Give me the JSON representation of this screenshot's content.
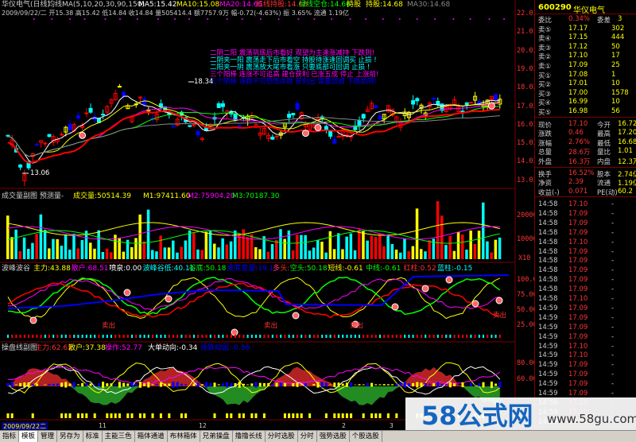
{
  "header": {
    "title": "华仪电气(日线)",
    "ma_label": "均线MA(5,10,20,30,90,150)",
    "ma5": "MA5:15.42",
    "ma10": "MA10:15.08",
    "ma20": "MA20:14.66",
    "signals": [
      "红线持股:14.68",
      "绿线空仓:14.66",
      "持股",
      "持股:14.68",
      "MA30:14.68"
    ],
    "ohlc_line": "2009/09/22/二  开15.38  高15.42  低14.84  收14.84  量505414.4  额7757.9万  幅-0.72(-4.63%)  振 3.65%  流通 1.19亿"
  },
  "annotations": [
    {
      "text": "二阴二阳 震荡筑底后市看好  观望为主逢涨减持  下跌则!",
      "color": "#ff00ff"
    },
    {
      "text": "二阴夹一阳 震荡走下后市看空  持股待涨逢回调买 止损 !",
      "color": "#00ffff"
    },
    {
      "text": "二阳夹一阴 震荡放大尾市看涨  只要底部可回调 止损 !",
      "color": "#00ffff"
    },
    {
      "text": "三个阳棒 连涨不可追高  建仓获利 已涨五成 停止 上涨前!",
      "color": "#ff00ff"
    },
    {
      "text": "三个阴棒 连跌不可恐慌杀跌 获利出 需要回调 下跌前阴!",
      "color": "#0000ff"
    }
  ],
  "price_labels": {
    "high": "18.34",
    "low": "13.06"
  },
  "price_axis": [
    "22.03",
    "21.03",
    "20.03",
    "19.03",
    "18.03",
    "17.03",
    "16.03",
    "15.03",
    "14.03",
    "13.03"
  ],
  "volume_panel": {
    "title": "成交量副图  预测量-",
    "values": [
      "成交量:50514.39",
      "M1:97411.60",
      "M2:75904.20",
      "M3:70187.30"
    ],
    "axis": [
      "20000",
      "10000",
      "X10"
    ]
  },
  "indicator_panel": {
    "title": "波峰波谷",
    "values": [
      "主力:43.88",
      "散户:68.51",
      "喷泉:0.00",
      "波峰谷低:40.11",
      "谷底:50.18",
      "波底变量:19.15",
      "多头:",
      "空头:50.18",
      "短线:-0.61",
      "中线:-0.61",
      "红柱:0.52",
      "蓝柱:-0.15"
    ],
    "axis": [
      "100.0",
      "75.00",
      "50.00",
      "25.00"
    ],
    "sell_tags": [
      "卖出",
      "卖出",
      "卖出",
      "卖出"
    ]
  },
  "bottom_panel": {
    "title": "操盘线副图",
    "values": [
      "主力:62.62",
      "散户:37.38",
      "操作:52.77",
      "大单动向:-0.34",
      "涨跌动因:-0.56"
    ],
    "axis": [
      "80.00",
      "60.00"
    ]
  },
  "date_axis": {
    "start": "2009/09/22二",
    "ticks": [
      "11",
      "12",
      "2",
      "3"
    ]
  },
  "quote": {
    "code": "600290",
    "name": "华仪电气",
    "rows": [
      {
        "l": "委比",
        "v": "0.34%",
        "l2": "委差",
        "v2": "3"
      },
      {
        "l": "卖⑤",
        "v": "17.17",
        "v2": "302"
      },
      {
        "l": "卖④",
        "v": "17.15",
        "v2": "444"
      },
      {
        "l": "卖③",
        "v": "17.12",
        "v2": "50"
      },
      {
        "l": "卖②",
        "v": "17.10",
        "v2": "17"
      },
      {
        "l": "卖①",
        "v": "17.09",
        "v2": "25"
      },
      {
        "l": "买①",
        "v": "17.08",
        "v2": "1"
      },
      {
        "l": "买②",
        "v": "17.01",
        "v2": "10"
      },
      {
        "l": "买③",
        "v": "17.00",
        "v2": "1578"
      },
      {
        "l": "买④",
        "v": "16.99",
        "v2": "10"
      },
      {
        "l": "买⑤",
        "v": "16.98",
        "v2": "56"
      },
      {
        "l": "现价",
        "v": "17.10",
        "l2": "今开",
        "v2": "16.72"
      },
      {
        "l": "涨跌",
        "v": "0.46",
        "l2": "最高",
        "v2": "17.20"
      },
      {
        "l": "涨幅",
        "v": "2.76%",
        "l2": "最低",
        "v2": "16.68"
      },
      {
        "l": "总量",
        "v": "28.6万",
        "l2": "量比",
        "v2": "1.01"
      },
      {
        "l": "外盘",
        "v": "16.3万",
        "l2": "内盘",
        "v2": "12.3万"
      },
      {
        "l": "换手",
        "v": "16.52%",
        "l2": "股本",
        "v2": "2.74亿"
      },
      {
        "l": "净资",
        "v": "2.39",
        "l2": "流通",
        "v2": "1.19亿"
      },
      {
        "l": "收益(-)",
        "v": "0.071",
        "l2": "PE(动)",
        "v2": "60.2"
      }
    ],
    "ticks": [
      {
        "t": "14:58",
        "p": "17.10",
        "v": "-"
      },
      {
        "t": "14:58",
        "p": "17.09",
        "v": "-"
      },
      {
        "t": "14:58",
        "p": "17.09",
        "v": "-"
      },
      {
        "t": "14:58",
        "p": "17.09",
        "v": "-"
      },
      {
        "t": "14:58",
        "p": "17.10",
        "v": "-"
      },
      {
        "t": "14:58",
        "p": "17.09",
        "v": "-"
      },
      {
        "t": "14:58",
        "p": "17.09",
        "v": "-"
      },
      {
        "t": "14:58",
        "p": "17.09",
        "v": "-"
      },
      {
        "t": "14:58",
        "p": "17.09",
        "v": "-"
      },
      {
        "t": "14:58",
        "p": "17.09",
        "v": "-"
      },
      {
        "t": "14:58",
        "p": "17.10",
        "v": "-"
      },
      {
        "t": "14:59",
        "p": "17.09",
        "v": "-"
      },
      {
        "t": "14:59",
        "p": "17.09",
        "v": "-"
      },
      {
        "t": "14:59",
        "p": "17.09",
        "v": "-"
      },
      {
        "t": "14:59",
        "p": "17.09",
        "v": "-"
      },
      {
        "t": "14:59",
        "p": "17.10",
        "v": "-"
      },
      {
        "t": "14:59",
        "p": "17.10",
        "v": "-"
      },
      {
        "t": "14:59",
        "p": "17.09",
        "v": "-"
      },
      {
        "t": "14:59",
        "p": "17.09",
        "v": "-"
      },
      {
        "t": "14:59",
        "p": "17.09",
        "v": "-"
      },
      {
        "t": "14:59",
        "p": "17.09",
        "v": "-"
      },
      {
        "t": "14:59",
        "p": "17.10",
        "v": "-"
      },
      {
        "t": "14:59",
        "p": "17.10",
        "v": "-"
      },
      {
        "t": "14:59",
        "p": "17.09",
        "v": "-"
      }
    ]
  },
  "tabs": [
    "指标",
    "模板",
    "管理",
    "另存为",
    "标准",
    "主能三色",
    "箱体通道",
    "布林箱体",
    "兄弟操盘",
    "撸撸长线",
    "分时选股",
    "分时",
    "强势选股",
    "个股选股"
  ],
  "watermark": {
    "text": "58公式网",
    "url": "www.58gu.com"
  },
  "colors": {
    "up": "#ff0000",
    "down": "#00ffff",
    "accent": "#ffff00"
  }
}
